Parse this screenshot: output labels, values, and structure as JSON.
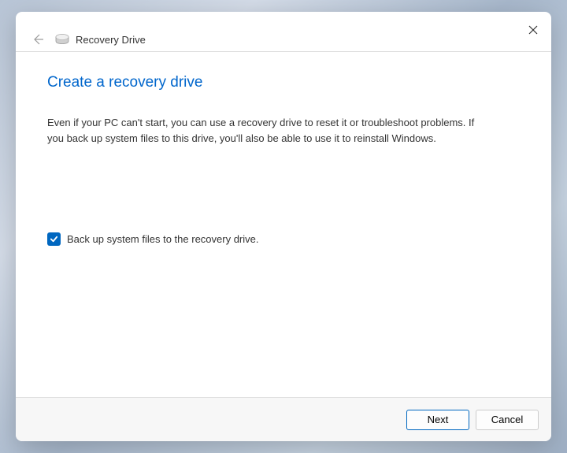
{
  "window": {
    "title": "Recovery Drive"
  },
  "content": {
    "heading": "Create a recovery drive",
    "description": "Even if your PC can't start, you can use a recovery drive to reset it or troubleshoot problems. If you back up system files to this drive, you'll also be able to use it to reinstall Windows."
  },
  "checkbox": {
    "checked": true,
    "label": "Back up system files to the recovery drive."
  },
  "buttons": {
    "next": "Next",
    "cancel": "Cancel"
  }
}
